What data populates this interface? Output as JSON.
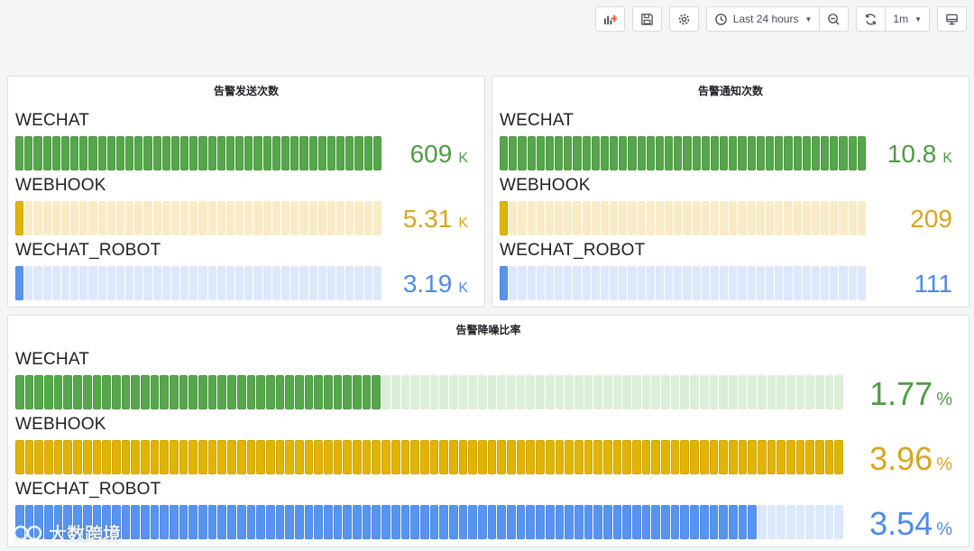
{
  "toolbar": {
    "time_range": "Last 24 hours",
    "refresh_interval": "1m",
    "icons": [
      "add-panel-icon",
      "save-icon",
      "gear-icon",
      "clock-icon",
      "zoom-out-icon",
      "refresh-icon",
      "tv-icon"
    ]
  },
  "panels": [
    {
      "title": "告警发送次数",
      "rows": [
        {
          "label": "WECHAT",
          "value": "609",
          "unit": "K",
          "fill": 1.0,
          "color": "#56a64b",
          "bg": "#d4e9cf"
        },
        {
          "label": "WEBHOOK",
          "value": "5.31",
          "unit": "K",
          "fill": 0.009,
          "color": "#e0b400",
          "bg": "#f8ebc5"
        },
        {
          "label": "WECHAT_ROBOT",
          "value": "3.19",
          "unit": "K",
          "fill": 0.005,
          "color": "#5794f2",
          "bg": "#dce8fb"
        }
      ]
    },
    {
      "title": "告警通知次数",
      "rows": [
        {
          "label": "WECHAT",
          "value": "10.8",
          "unit": "K",
          "fill": 1.0,
          "color": "#56a64b",
          "bg": "#d4e9cf"
        },
        {
          "label": "WEBHOOK",
          "value": "209",
          "unit": "",
          "fill": 0.019,
          "color": "#e0b400",
          "bg": "#f8ebc5"
        },
        {
          "label": "WECHAT_ROBOT",
          "value": "111",
          "unit": "",
          "fill": 0.01,
          "color": "#5794f2",
          "bg": "#dce8fb"
        }
      ]
    },
    {
      "title": "告警降噪比率",
      "rows": [
        {
          "label": "WECHAT",
          "value": "1.77",
          "unit": "%",
          "fill": 0.447,
          "color": "#56a64b",
          "bg": "#dbeed7"
        },
        {
          "label": "WEBHOOK",
          "value": "3.96",
          "unit": "%",
          "fill": 1.0,
          "color": "#e0b400",
          "bg": "#f8ebc5"
        },
        {
          "label": "WECHAT_ROBOT",
          "value": "3.54",
          "unit": "%",
          "fill": 0.894,
          "color": "#5794f2",
          "bg": "#dce8fb"
        }
      ]
    }
  ],
  "watermark": "大数跨境"
}
